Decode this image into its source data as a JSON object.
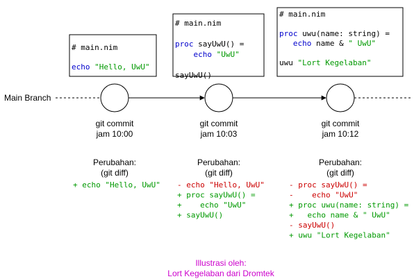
{
  "branch_label": "Main Branch",
  "colors": {
    "keyword": "#0000cc",
    "string": "#009900",
    "plain": "#000000",
    "added": "#009900",
    "removed": "#cc0000",
    "credit": "#cc00cc"
  },
  "commits": [
    {
      "code_lines": [
        [
          {
            "t": "# main.nim",
            "c": "plain"
          }
        ],
        [],
        [
          {
            "t": "echo ",
            "c": "keyword"
          },
          {
            "t": "\"Hello, UwU\"",
            "c": "string"
          }
        ]
      ],
      "commit_label": "git commit",
      "time": "jam 10:00",
      "changes_title": "Perubahan:",
      "changes_sub": "(git diff)",
      "diff": [
        {
          "t": "+ echo \"Hello, UwU\"",
          "c": "added"
        }
      ]
    },
    {
      "code_lines": [
        [
          {
            "t": "# main.nim",
            "c": "plain"
          }
        ],
        [],
        [
          {
            "t": "proc ",
            "c": "keyword"
          },
          {
            "t": "sayUwU() =",
            "c": "plain"
          }
        ],
        [
          {
            "t": "    echo ",
            "c": "keyword"
          },
          {
            "t": "\"UwU\"",
            "c": "string"
          }
        ],
        [],
        [
          {
            "t": "sayUwU()",
            "c": "plain"
          }
        ]
      ],
      "commit_label": "git commit",
      "time": "jam 10:03",
      "changes_title": "Perubahan:",
      "changes_sub": "(git diff)",
      "diff": [
        {
          "t": "- echo \"Hello, UwU\"",
          "c": "removed"
        },
        {
          "t": "+ proc sayUwU() =",
          "c": "added"
        },
        {
          "t": "+    echo \"UwU\"",
          "c": "added"
        },
        {
          "t": "+ sayUwU()",
          "c": "added"
        }
      ]
    },
    {
      "code_lines": [
        [
          {
            "t": "# main.nim",
            "c": "plain"
          }
        ],
        [],
        [
          {
            "t": "proc ",
            "c": "keyword"
          },
          {
            "t": "uwu(name: string) =",
            "c": "plain"
          }
        ],
        [
          {
            "t": "   echo ",
            "c": "keyword"
          },
          {
            "t": "name & ",
            "c": "plain"
          },
          {
            "t": "\" UwU\"",
            "c": "string"
          }
        ],
        [],
        [
          {
            "t": "uwu ",
            "c": "plain"
          },
          {
            "t": "\"Lort Kegelaban\"",
            "c": "string"
          }
        ]
      ],
      "commit_label": "git commit",
      "time": "jam 10:12",
      "changes_title": "Perubahan:",
      "changes_sub": "(git diff)",
      "diff": [
        {
          "t": "- proc sayUwU() =",
          "c": "removed"
        },
        {
          "t": "-    echo \"UwU\"",
          "c": "removed"
        },
        {
          "t": "+ proc uwu(name: string) =",
          "c": "added"
        },
        {
          "t": "+   echo name & \" UwU\"",
          "c": "added"
        },
        {
          "t": "- sayUwU()",
          "c": "removed"
        },
        {
          "t": "+ uwu \"Lort Kegelaban\"",
          "c": "added"
        }
      ]
    }
  ],
  "credit_line1": "Illustrasi oleh:",
  "credit_line2": "Lort Kegelaban dari Dromtek"
}
